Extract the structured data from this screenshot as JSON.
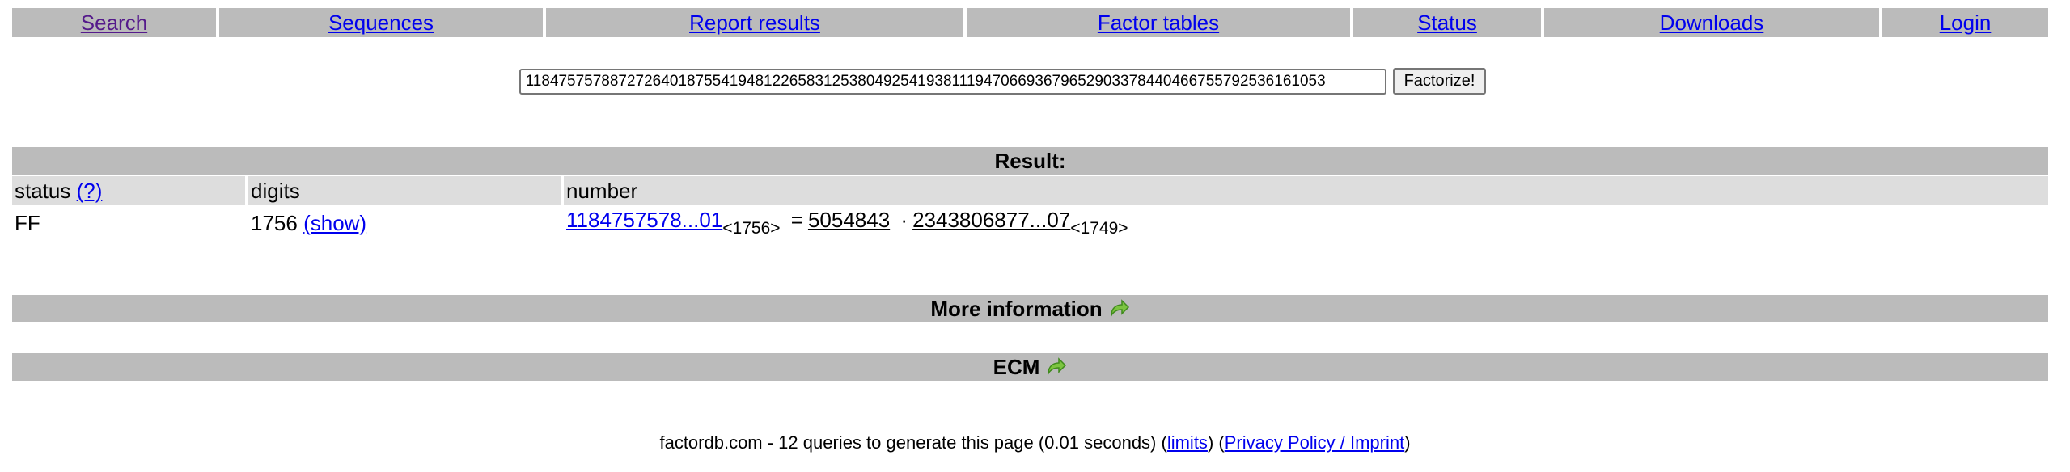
{
  "nav": {
    "items": [
      {
        "label": "Search"
      },
      {
        "label": "Sequences"
      },
      {
        "label": "Report results"
      },
      {
        "label": "Factor tables"
      },
      {
        "label": "Status"
      },
      {
        "label": "Downloads"
      },
      {
        "label": "Login"
      }
    ]
  },
  "search": {
    "value": "1184757578872726401875541948122658312538049254193811194706693679652903378440466755792536161053",
    "button_label": "Factorize!"
  },
  "result": {
    "title": "Result:",
    "headers": {
      "status": "status",
      "help": "(?)",
      "digits": "digits",
      "number": "number"
    },
    "row": {
      "status": "FF",
      "digits": "1756",
      "show": "(show)",
      "number_link": "1184757578...01",
      "number_len": "<1756>",
      "equals": "=",
      "factor1": "5054843",
      "dot": "·",
      "factor2": "2343806877...07",
      "factor2_len": "<1749>"
    }
  },
  "sections": {
    "more_info": "More information",
    "ecm": "ECM"
  },
  "footer": {
    "text": "factordb.com - 12 queries to generate this page (0.01 seconds) (",
    "limits": "limits",
    "mid": ") (",
    "privacy": "Privacy Policy / Imprint",
    "end": ")"
  },
  "colors": {
    "nav_bg": "#bbbbbb",
    "header_bg": "#dddddd",
    "link": "#0000ee",
    "visited": "#551a8b",
    "arrow": "#7cc440"
  }
}
